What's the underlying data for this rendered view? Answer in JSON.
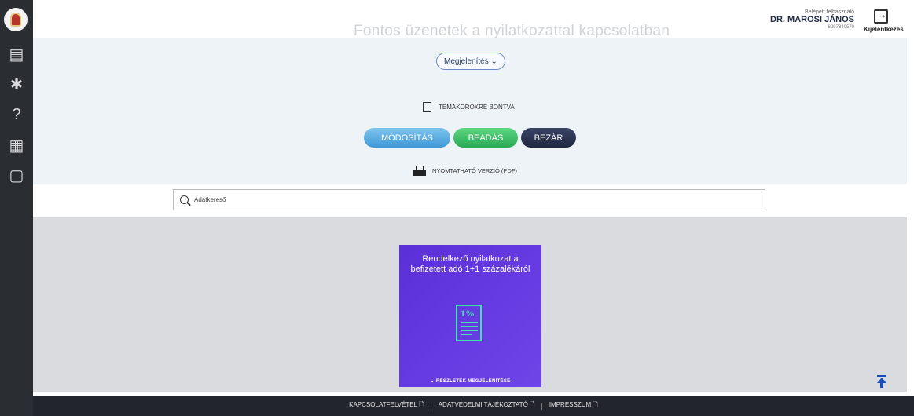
{
  "header": {
    "title": "Fontos üzenetek a nyilatkozattal kapcsolatban",
    "user_label": "Belépett felhasználó",
    "user_name": "DR. MAROSI JÁNOS",
    "user_id": "8297340570",
    "logout_label": "Kijelentkezés"
  },
  "sidebar": {
    "items": [
      {
        "icon": "declaration-list-icon",
        "glyph": "▤"
      },
      {
        "icon": "accessibility-icon",
        "glyph": "✱"
      },
      {
        "icon": "help-icon",
        "glyph": "?"
      },
      {
        "icon": "calendar-2020-icon",
        "glyph": "▦"
      },
      {
        "icon": "document-icon",
        "glyph": "▢"
      }
    ]
  },
  "panel": {
    "display_button": "Megjelenítés ⌄",
    "topics_label": "TÉMAKÖRÖKRE BONTVA",
    "modify_button": "MÓDOSÍTÁS",
    "submit_button": "BEADÁS",
    "close_button": "BEZÁR",
    "printable_label": "NYOMTATHATÓ VERZIÓ (PDF)"
  },
  "search": {
    "placeholder": "Adatkereső"
  },
  "card": {
    "title": "Rendelkező nyilatkozat a befizetett adó 1+1 százalékáról",
    "icon_text": "1%",
    "details_label": "⌄ RÉSZLETEK MEGJELENÍTÉSE"
  },
  "footer": {
    "links": [
      "KAPCSOLATFELVÉTEL 🗋",
      "ADATVÉDELMI TÁJÉKOZTATÓ 🗋",
      "IMPRESSZUM 🗋"
    ],
    "separator": "|"
  },
  "colors": {
    "sidebar": "#2a2d31",
    "panel": "#eef3f8",
    "content": "#d9dbde",
    "card": "#5b2fd8",
    "card_accent": "#3fe3a8",
    "modify": "#3f98d6",
    "submit": "#2aa956",
    "close": "#1f2740"
  }
}
